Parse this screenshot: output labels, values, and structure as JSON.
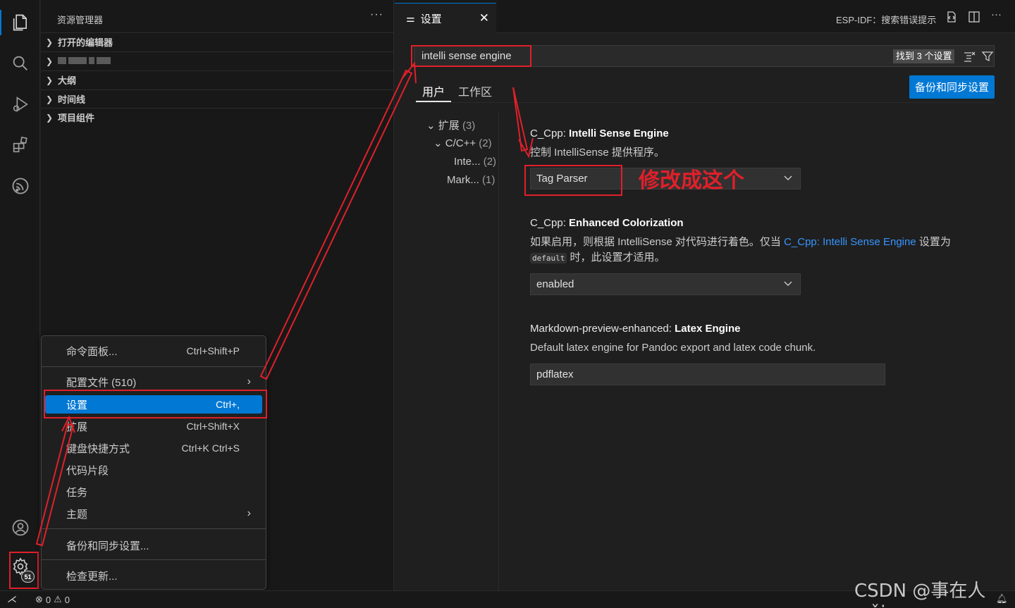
{
  "sidebar": {
    "title": "资源管理器",
    "more": "···",
    "sections": [
      "打开的编辑器",
      "",
      "大纲",
      "时间线",
      "项目组件"
    ]
  },
  "activity": {
    "badge": "51"
  },
  "menu": {
    "items": [
      {
        "label": "命令面板...",
        "shortcut": "Ctrl+Shift+P"
      },
      {
        "label": "配置文件 (510)",
        "shortcut": ""
      },
      {
        "label": "设置",
        "shortcut": "Ctrl+,"
      },
      {
        "label": "扩展",
        "shortcut": "Ctrl+Shift+X"
      },
      {
        "label": "键盘快捷方式",
        "shortcut": "Ctrl+K Ctrl+S"
      },
      {
        "label": "代码片段",
        "shortcut": ""
      },
      {
        "label": "任务",
        "shortcut": ""
      },
      {
        "label": "主题",
        "shortcut": ""
      },
      {
        "label": "备份和同步设置...",
        "shortcut": ""
      },
      {
        "label": "检查更新...",
        "shortcut": ""
      }
    ]
  },
  "editor": {
    "tab": {
      "title": "设置",
      "close": "✕"
    },
    "toolbar": {
      "esp_idf": "ESP-IDF：搜索错误提示"
    },
    "search": {
      "value": "intelli sense engine",
      "found": "找到 3 个设置"
    },
    "scopes": {
      "user": "用户",
      "workspace": "工作区"
    },
    "backup_button": "备份和同步设置",
    "toc": [
      {
        "label": "扩展",
        "count": "(3)"
      },
      {
        "label": "C/C++",
        "count": "(2)"
      },
      {
        "label": "Inte...",
        "count": "(2)"
      },
      {
        "label": "Mark...",
        "count": "(1)"
      }
    ],
    "settings": [
      {
        "prefix": "C_Cpp: ",
        "name": "Intelli Sense Engine",
        "desc": "控制 IntelliSense 提供程序。",
        "value": "Tag Parser"
      },
      {
        "prefix": "C_Cpp: ",
        "name": "Enhanced Colorization",
        "desc_a": "如果启用，则根据 IntelliSense 对代码进行着色。仅当 ",
        "desc_link": "C_Cpp: Intelli Sense Engine",
        "desc_b": " 设置为",
        "desc_code": "default",
        "desc_c": " 时，此设置才适用。",
        "value": "enabled"
      },
      {
        "prefix": "Markdown-preview-enhanced: ",
        "name": "Latex Engine",
        "desc": "Default latex engine for Pandoc export and latex code chunk.",
        "value": "pdflatex"
      }
    ],
    "annotation": "修改成这个"
  },
  "statusbar": {
    "errors": "0",
    "warnings": "0"
  },
  "watermark": "CSDN @事在人wěi",
  "colors": {
    "accent": "#0078d4",
    "annotation_red": "#e0202a",
    "link": "#3794ff"
  }
}
